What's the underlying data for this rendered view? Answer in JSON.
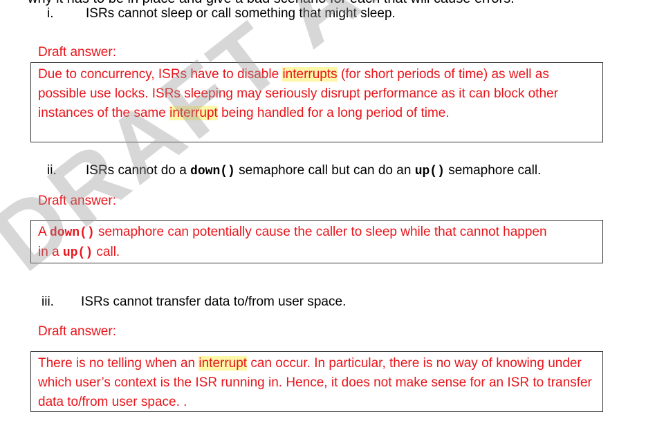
{
  "top_cutoff": "why it has to be in place and give a bad scenario for each that will cause errors.",
  "items": [
    {
      "number": "i.",
      "question": "ISRs cannot sleep or call something that might sleep.",
      "draft_label": "Draft answer:",
      "answer": {
        "p1": "Due to concurrency, ISRs have to disable ",
        "hl1": "interrupts",
        "p2": " (for short periods of time) as well as possible use locks. ISRs sleeping may seriously disrupt performance as it can block other instances of the same ",
        "hl2": "interrupt",
        "p3": " being handled for a long period of time."
      }
    },
    {
      "number": "ii.",
      "q_p1": "ISRs cannot do a ",
      "q_code1": "down()",
      "q_p2": " semaphore call but can do an ",
      "q_code2": "up()",
      "q_p3": " semaphore call.",
      "draft_label": "Draft answer:",
      "answer": {
        "p1": "A ",
        "code1": "down()",
        "p2": " semaphore can potentially cause the caller to sleep while that cannot happen in a ",
        "code2": "up()",
        "p3": " call."
      }
    },
    {
      "number": "iii.",
      "question": "ISRs cannot transfer data to/from user space.",
      "draft_label": "Draft answer:",
      "answer": {
        "p1": "There is no telling when an ",
        "hl1": "interrupt",
        "p2": " can occur. In particular, there is no way of knowing under which user’s context is the ISR running in. Hence, it does not make sense for an ISR to transfer data to/from user space. ."
      }
    }
  ],
  "watermark": "DRAFT ANSWERS",
  "colors": {
    "answer_text": "#e8141a",
    "highlight": "#fdf7a8",
    "watermark": "#969696"
  }
}
